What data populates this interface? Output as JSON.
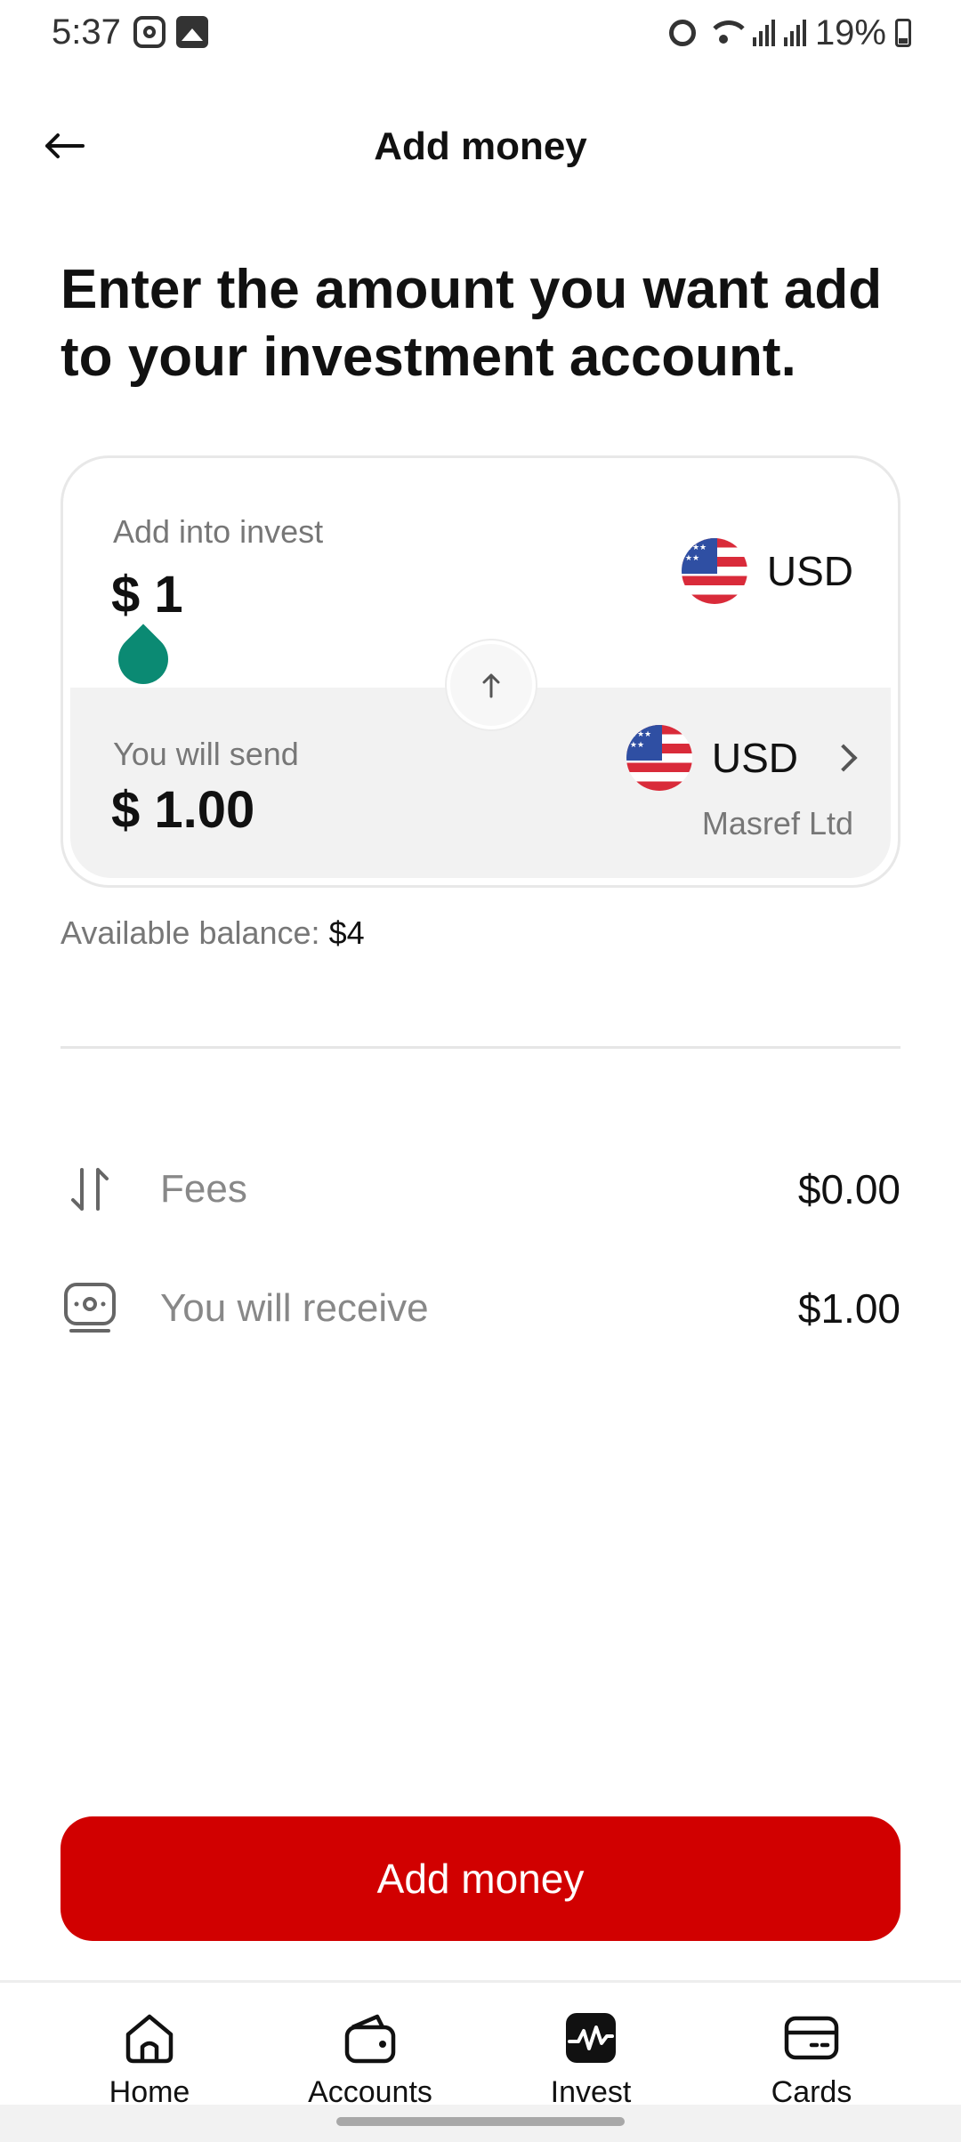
{
  "status_bar": {
    "time": "5:37",
    "battery": "19%"
  },
  "header": {
    "title": "Add money"
  },
  "headline": "Enter the amount you want add to your investment account.",
  "amount_card": {
    "top_label": "Add into invest",
    "top_amount": "$ 1",
    "top_currency": "USD",
    "bottom_label": "You will send",
    "bottom_amount": "$ 1.00",
    "bottom_currency": "USD",
    "provider": "Masref Ltd"
  },
  "balance": {
    "label": "Available balance: ",
    "value": "$4"
  },
  "summary": [
    {
      "label": "Fees",
      "value": "$0.00",
      "icon": "transfer-arrows-icon"
    },
    {
      "label": "You will receive",
      "value": "$1.00",
      "icon": "cash-icon"
    }
  ],
  "primary_button": {
    "label": "Add money",
    "color": "#d10000"
  },
  "nav": [
    {
      "label": "Home",
      "icon": "home-icon"
    },
    {
      "label": "Accounts",
      "icon": "wallet-icon"
    },
    {
      "label": "Invest",
      "icon": "invest-icon",
      "active": true
    },
    {
      "label": "Cards",
      "icon": "card-icon"
    }
  ],
  "colors": {
    "accent": "#d10000",
    "drop": "#0b8a73"
  }
}
